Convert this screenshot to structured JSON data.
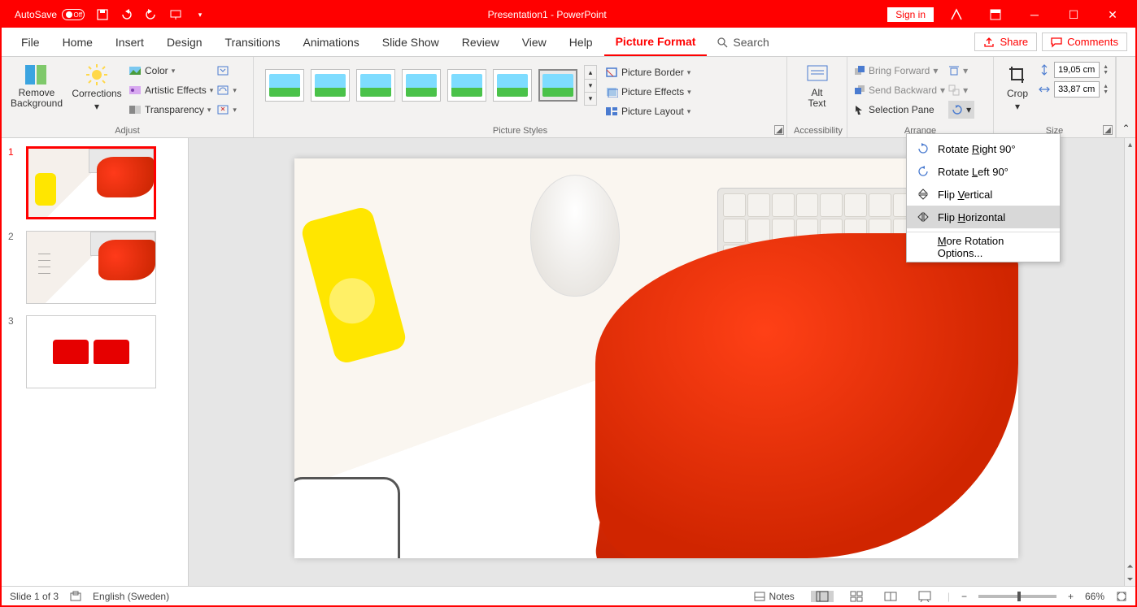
{
  "titlebar": {
    "autosave_label": "AutoSave",
    "autosave_state": "Off",
    "title": "Presentation1  -  PowerPoint",
    "signin": "Sign in"
  },
  "tabs": {
    "file": "File",
    "home": "Home",
    "insert": "Insert",
    "design": "Design",
    "transitions": "Transitions",
    "animations": "Animations",
    "slideshow": "Slide Show",
    "review": "Review",
    "view": "View",
    "help": "Help",
    "picture_format": "Picture Format",
    "search": "Search",
    "share": "Share",
    "comments": "Comments"
  },
  "ribbon": {
    "adjust": {
      "remove_bg": "Remove\nBackground",
      "corrections": "Corrections",
      "color": "Color",
      "artistic": "Artistic Effects",
      "transparency": "Transparency",
      "label": "Adjust"
    },
    "styles": {
      "border": "Picture Border",
      "effects": "Picture Effects",
      "layout": "Picture Layout",
      "label": "Picture Styles"
    },
    "accessibility": {
      "alt_text": "Alt\nText",
      "label": "Accessibility"
    },
    "arrange": {
      "bring_forward": "Bring Forward",
      "send_backward": "Send Backward",
      "selection_pane": "Selection Pane",
      "label": "Arrange"
    },
    "size": {
      "crop": "Crop",
      "height": "19,05 cm",
      "width": "33,87 cm",
      "label": "Size"
    }
  },
  "rotate_menu": {
    "rotate_right": "Rotate Right 90°",
    "rotate_left": "Rotate Left 90°",
    "flip_vertical": "Flip Vertical",
    "flip_horizontal": "Flip Horizontal",
    "more": "More Rotation Options..."
  },
  "slides": {
    "s1": "1",
    "s2": "2",
    "s3": "3"
  },
  "statusbar": {
    "slide_of": "Slide 1 of 3",
    "language": "English (Sweden)",
    "notes": "Notes",
    "zoom": "66%"
  }
}
